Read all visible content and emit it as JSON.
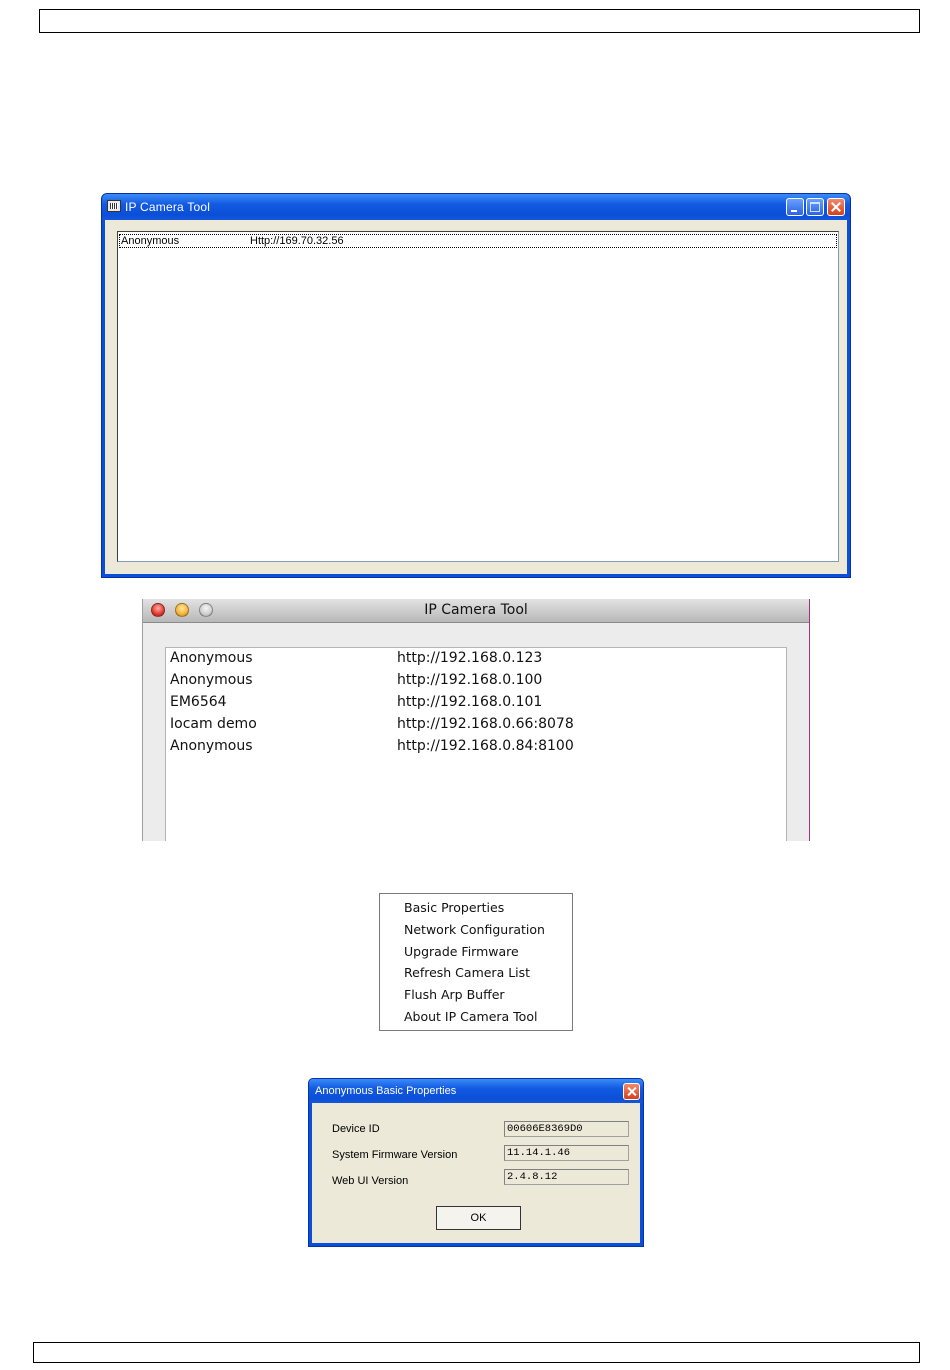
{
  "xp_window": {
    "title": "IP Camera Tool",
    "rows": [
      {
        "name": "Anonymous",
        "url": "Http://169.70.32.56"
      }
    ]
  },
  "mac_window": {
    "title": "IP Camera Tool",
    "rows": [
      {
        "name": "Anonymous",
        "url": "http://192.168.0.123"
      },
      {
        "name": "Anonymous",
        "url": "http://192.168.0.100"
      },
      {
        "name": "EM6564",
        "url": "http://192.168.0.101"
      },
      {
        "name": "Iocam demo",
        "url": "http://192.168.0.66:8078"
      },
      {
        "name": "Anonymous",
        "url": "http://192.168.0.84:8100"
      }
    ]
  },
  "context_menu": {
    "items": [
      "Basic Properties",
      "Network Configuration",
      "Upgrade Firmware",
      "Refresh Camera List",
      "Flush Arp Buffer",
      "About IP Camera Tool"
    ]
  },
  "properties_dialog": {
    "title": "Anonymous Basic Properties",
    "fields": [
      {
        "label": "Device ID",
        "value": "00606E8369D0"
      },
      {
        "label": "System Firmware Version",
        "value": "11.14.1.46"
      },
      {
        "label": "Web UI Version",
        "value": "2.4.8.12"
      }
    ],
    "ok_label": "OK"
  },
  "icons": {
    "xp_app_icon": "camera-tool-icon",
    "window_controls": [
      "minimize-icon",
      "maximize-icon",
      "close-icon"
    ],
    "mac_controls": [
      "close-light",
      "minimize-light",
      "zoom-light"
    ]
  },
  "colors": {
    "xp_titlebar": "#0b4fd6",
    "xp_client": "#ece9d8",
    "mac_close": "#e03a2e",
    "mac_minimize": "#f4b43a"
  }
}
